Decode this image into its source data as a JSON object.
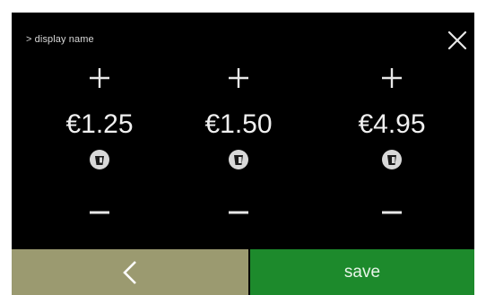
{
  "breadcrumb": "> display name",
  "icons": {
    "close": "close-icon",
    "plus": "plus-icon",
    "minus": "minus-icon",
    "cup": "cup-icon",
    "back": "chevron-left-icon"
  },
  "products": [
    {
      "price": "€1.25"
    },
    {
      "price": "€1.50"
    },
    {
      "price": "€4.95"
    }
  ],
  "footer": {
    "save_label": "save"
  },
  "colors": {
    "background": "#000000",
    "back_button": "#9b9a70",
    "save_button": "#1d8a2c",
    "text": "#e8e8e8"
  }
}
